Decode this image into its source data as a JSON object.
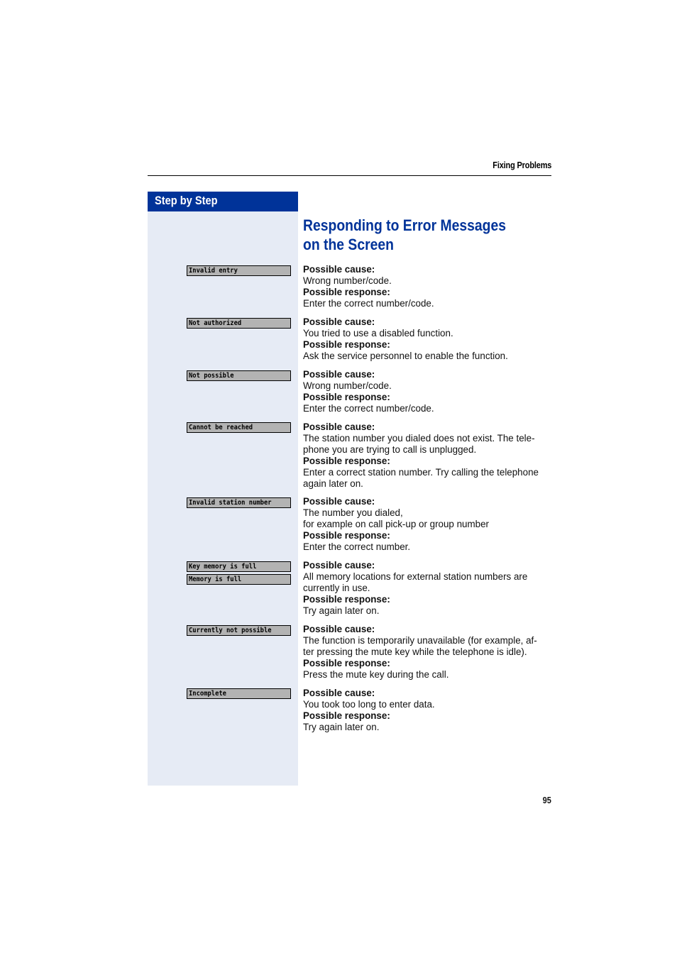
{
  "header": {
    "section_title": "Fixing Problems"
  },
  "sidebar": {
    "heading": "Step by Step"
  },
  "page_title": "Responding to Error Messages on the Screen",
  "labels": {
    "cause": "Possible cause:",
    "response": "Possible response:"
  },
  "entries": [
    {
      "displays": [
        "Invalid entry"
      ],
      "cause": [
        "Wrong number/code."
      ],
      "response": [
        "Enter the correct number/code."
      ]
    },
    {
      "displays": [
        "Not authorized"
      ],
      "cause": [
        "You tried to use a disabled function."
      ],
      "response": [
        "Ask the service personnel to enable the function."
      ]
    },
    {
      "displays": [
        "Not possible"
      ],
      "cause": [
        "Wrong number/code."
      ],
      "response": [
        "Enter the correct number/code."
      ]
    },
    {
      "displays": [
        "Cannot be reached"
      ],
      "cause": [
        "The station number you dialed does not exist. The tele-",
        "phone you are trying to call is unplugged."
      ],
      "response": [
        "Enter a correct station number. Try calling the telephone",
        "again later on."
      ]
    },
    {
      "displays": [
        "Invalid station number"
      ],
      "cause": [
        "The number you dialed,",
        "for example on call pick-up or group number"
      ],
      "response": [
        "Enter the correct number."
      ]
    },
    {
      "displays": [
        "Key memory is full",
        "Memory is full"
      ],
      "cause": [
        "All memory locations for external station numbers are",
        "currently in use."
      ],
      "response": [
        "Try again later on."
      ]
    },
    {
      "displays": [
        "Currently not possible"
      ],
      "cause": [
        "The function is temporarily unavailable (for example, af-",
        "ter pressing the mute key while the telephone is idle)."
      ],
      "response": [
        "Press the mute key during the call."
      ]
    },
    {
      "displays": [
        "Incomplete"
      ],
      "cause": [
        "You took too long to enter data."
      ],
      "response": [
        "Try again later on."
      ]
    }
  ],
  "footer": {
    "page_number": "95"
  }
}
